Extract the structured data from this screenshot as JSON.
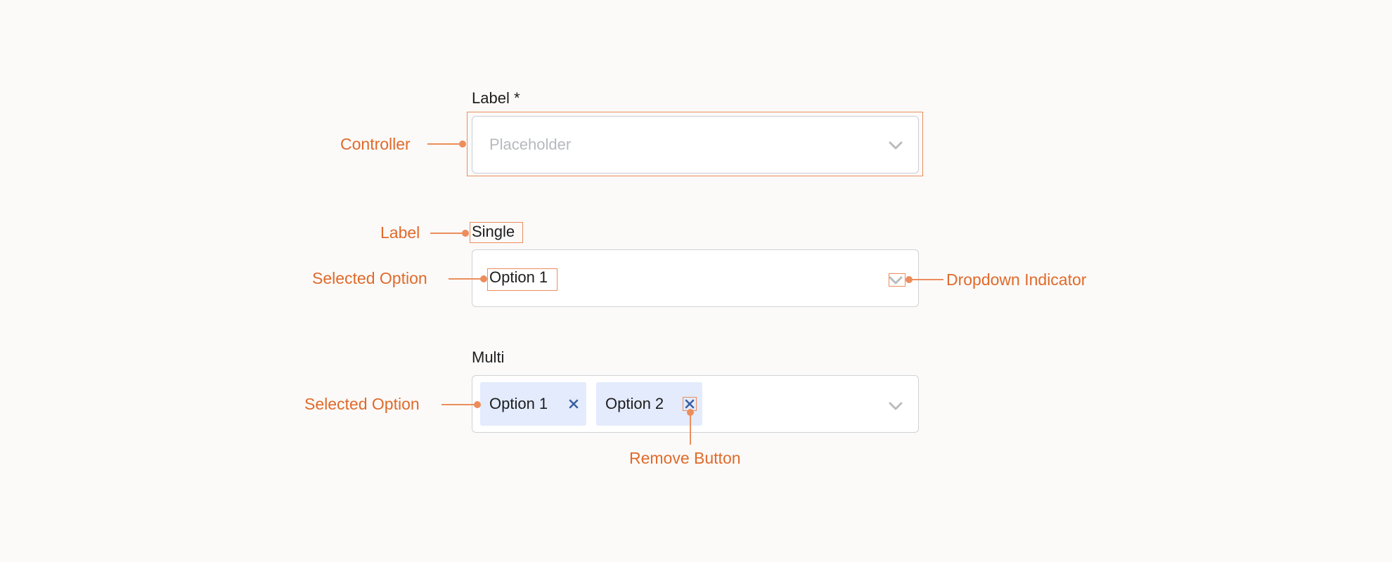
{
  "fields": {
    "first": {
      "label": "Label *",
      "placeholder": "Placeholder"
    },
    "single": {
      "label": "Single",
      "selected": "Option 1"
    },
    "multi": {
      "label": "Multi",
      "chips": [
        {
          "label": "Option 1"
        },
        {
          "label": "Option 2"
        }
      ]
    }
  },
  "annotations": {
    "controller": "Controller",
    "label": "Label",
    "selected_option_single": "Selected Option",
    "dropdown_indicator": "Dropdown Indicator",
    "selected_option_multi": "Selected Option",
    "remove_button": "Remove Button"
  },
  "colors": {
    "annotation": "#e06a2b",
    "chip_background": "#e3ebfc",
    "remove_icon": "#3a5fa0",
    "chevron": "#b9bbbf"
  },
  "icons": {
    "chevron": "chevron-down-icon",
    "remove": "close-icon"
  }
}
